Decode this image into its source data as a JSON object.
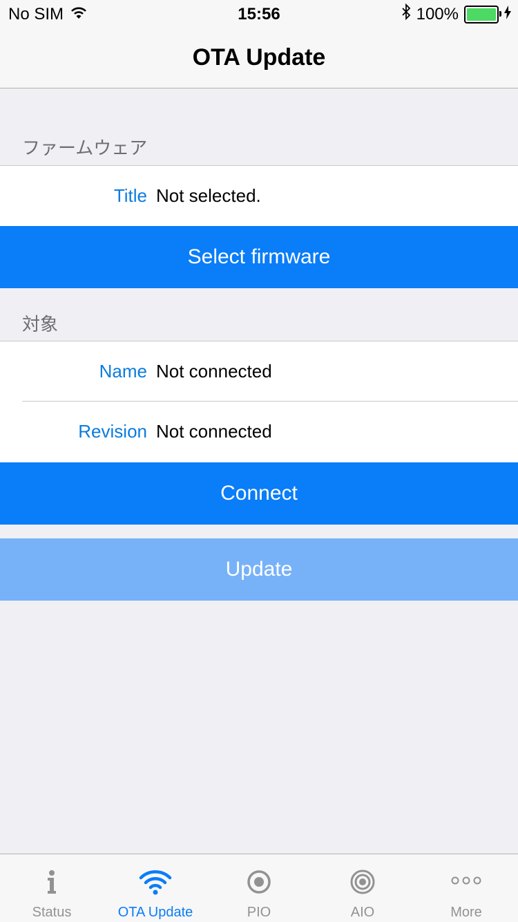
{
  "status_bar": {
    "carrier": "No SIM",
    "time": "15:56",
    "battery": "100%"
  },
  "nav": {
    "title": "OTA Update"
  },
  "firmware_section": {
    "header": "ファームウェア",
    "title_label": "Title",
    "title_value": "Not selected.",
    "select_button": "Select firmware"
  },
  "target_section": {
    "header": "対象",
    "name_label": "Name",
    "name_value": "Not connected",
    "revision_label": "Revision",
    "revision_value": "Not connected",
    "connect_button": "Connect"
  },
  "update_button": "Update",
  "tabs": [
    {
      "label": "Status",
      "icon": "info-icon",
      "active": false
    },
    {
      "label": "OTA Update",
      "icon": "wifi-icon",
      "active": true
    },
    {
      "label": "PIO",
      "icon": "target-icon",
      "active": false
    },
    {
      "label": "AIO",
      "icon": "double-target-icon",
      "active": false
    },
    {
      "label": "More",
      "icon": "more-icon",
      "active": false
    }
  ],
  "colors": {
    "accent": "#0a7df8",
    "disabled": "#77b2f8",
    "label": "#0a7cde",
    "background": "#efeff4"
  }
}
